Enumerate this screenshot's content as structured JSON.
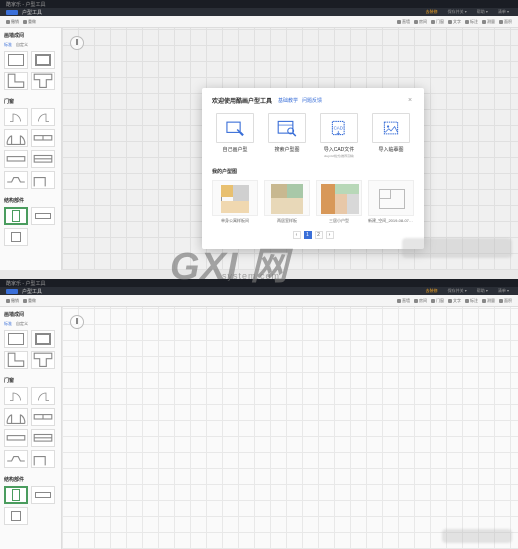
{
  "app": {
    "title_prefix": "酷家乐",
    "tool_name": "户型工具"
  },
  "header": {
    "buttons": {
      "tutorial": "去装修",
      "save": "保存并关 ▾",
      "share": "帮助 ▾",
      "export": "清单 ▾"
    }
  },
  "toolbar": {
    "undo": "撤销",
    "redo": "重做",
    "wall": "直墙",
    "room": "房间",
    "door": "门窗",
    "text": "文字",
    "measure": "标注",
    "ruler": "测量",
    "area": "面积"
  },
  "sidebar": {
    "sec1_title": "画墙成间",
    "tabs": {
      "std": "标准",
      "custom": "自定义"
    },
    "sec2_title": "门窗",
    "sec3_title": "结构部件"
  },
  "modal": {
    "title": "欢迎使用酷画户型工具",
    "link1": "基础教学",
    "link2": "问题反馈",
    "options": [
      {
        "label": "自己画户型"
      },
      {
        "label": "搜索户型图"
      },
      {
        "label": "导入CAD文件",
        "sub": "dwg/dxf格式(推荐高精)"
      },
      {
        "label": "导入临摹图"
      }
    ],
    "recent_title": "我的户型图",
    "recent": [
      {
        "label": "单身公寓样板间"
      },
      {
        "label": "两居室样板"
      },
      {
        "label": "三居小户型"
      },
      {
        "label": "新建_空间_2019-08-07 10:53"
      }
    ],
    "pager": {
      "prev": "‹",
      "p1": "1",
      "p2": "2",
      "next": "›"
    }
  },
  "watermark": {
    "big": "GXI 网",
    "dom": "system.com"
  }
}
